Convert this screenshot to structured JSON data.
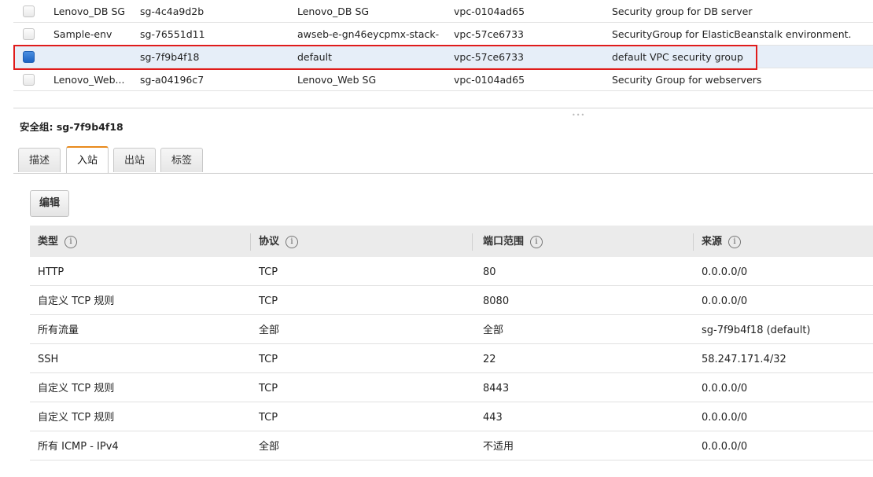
{
  "security_groups": {
    "rows": [
      {
        "name": "Lenovo_DB SG",
        "group_id": "sg-4c4a9d2b",
        "group_name": "Lenovo_DB SG",
        "vpc_id": "vpc-0104ad65",
        "description": "Security group for DB server",
        "selected": false
      },
      {
        "name": "Sample-env",
        "group_id": "sg-76551d11",
        "group_name": "awseb-e-gn46eycpmx-stack-...",
        "vpc_id": "vpc-57ce6733",
        "description": "SecurityGroup for ElasticBeanstalk environment.",
        "selected": false
      },
      {
        "name": "",
        "group_id": "sg-7f9b4f18",
        "group_name": "default",
        "vpc_id": "vpc-57ce6733",
        "description": "default VPC security group",
        "selected": true
      },
      {
        "name": "Lenovo_Web...",
        "group_id": "sg-a04196c7",
        "group_name": "Lenovo_Web SG",
        "vpc_id": "vpc-0104ad65",
        "description": "Security Group for webservers",
        "selected": false
      }
    ]
  },
  "detail": {
    "title": "安全组: sg-7f9b4f18",
    "tabs": [
      "描述",
      "入站",
      "出站",
      "标签"
    ],
    "active_tab": "入站",
    "edit_label": "编辑",
    "columns": [
      "类型",
      "协议",
      "端口范围",
      "来源"
    ],
    "info_glyph": "i",
    "rules": [
      {
        "type": "HTTP",
        "protocol": "TCP",
        "port_range": "80",
        "source": "0.0.0.0/0"
      },
      {
        "type": "自定义 TCP 规则",
        "protocol": "TCP",
        "port_range": "8080",
        "source": "0.0.0.0/0"
      },
      {
        "type": "所有流量",
        "protocol": "全部",
        "port_range": "全部",
        "source": "sg-7f9b4f18 (default)"
      },
      {
        "type": "SSH",
        "protocol": "TCP",
        "port_range": "22",
        "source": "58.247.171.4/32"
      },
      {
        "type": "自定义 TCP 规则",
        "protocol": "TCP",
        "port_range": "8443",
        "source": "0.0.0.0/0"
      },
      {
        "type": "自定义 TCP 规则",
        "protocol": "TCP",
        "port_range": "443",
        "source": "0.0.0.0/0"
      },
      {
        "type": "所有 ICMP - IPv4",
        "protocol": "全部",
        "port_range": "不适用",
        "source": "0.0.0.0/0"
      }
    ]
  },
  "colors": {
    "highlight": "#e01b1b",
    "active_tab_accent": "#e88a1c",
    "checkbox_checked": "#1d63c2",
    "selected_row": "#e6eef8"
  }
}
